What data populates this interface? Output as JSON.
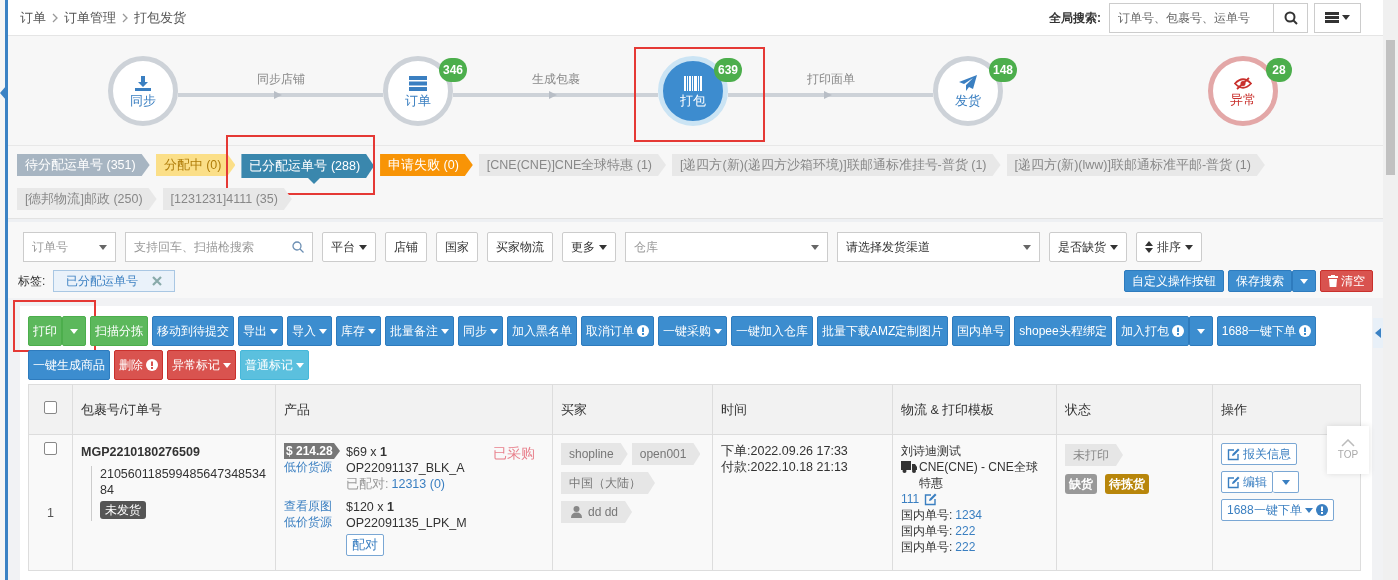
{
  "breadcrumb": [
    "订单",
    "订单管理",
    "打包发货"
  ],
  "global_search": {
    "label": "全局搜索:",
    "placeholder": "订单号、包裹号、运单号"
  },
  "steps": [
    {
      "kind": "sync",
      "label": "同步",
      "next_label": "同步店铺",
      "selected": false,
      "annotated": false
    },
    {
      "kind": "order",
      "label": "订单",
      "count": "346",
      "next_label": "生成包裹",
      "selected": false,
      "annotated": false
    },
    {
      "kind": "pack",
      "label": "打包",
      "count": "639",
      "next_label": "打印面单",
      "selected": true,
      "annotated": true
    },
    {
      "kind": "ship",
      "label": "发货",
      "count": "148",
      "selected": false,
      "annotated": false
    },
    {
      "kind": "abnormal",
      "label": "异常",
      "count": "28",
      "selected": false,
      "annotated": false
    }
  ],
  "status_tabs": [
    {
      "label": "待分配运单号 (351)",
      "color": "#a7b5c2",
      "selected": false,
      "annotated": false
    },
    {
      "label": "分配中 (0)",
      "color": "#fbdf88",
      "selected": false,
      "annotated": false
    },
    {
      "label": "已分配运单号 (288)",
      "color": "#3a87ad",
      "selected": true,
      "annotated": true
    },
    {
      "label": "申请失败 (0)",
      "color": "#f89406",
      "selected": false,
      "annotated": false
    },
    {
      "label": "[CNE(CNE)]CNE全球特惠 (1)",
      "color": "#e8e8e8",
      "selected": false,
      "annotated": false
    },
    {
      "label": "[递四方(新)(递四方沙箱环境)]联邮通标准挂号-普货 (1)",
      "color": "#e8e8e8",
      "selected": false,
      "annotated": false
    },
    {
      "label": "[递四方(新)(lww)]联邮通标准平邮-普货 (1)",
      "color": "#e8e8e8",
      "selected": false,
      "annotated": false
    },
    {
      "label": "[德邦物流]邮政 (250)",
      "color": "#e8e8e8",
      "selected": false,
      "annotated": false
    },
    {
      "label": "[1231231]4111 (35)",
      "color": "#e8e8e8",
      "selected": false,
      "annotated": false
    }
  ],
  "filters": [
    {
      "kind": "key-select",
      "placeholder": "订单号"
    },
    {
      "kind": "search",
      "placeholder": "支持回车、扫描枪搜索"
    },
    {
      "kind": "button",
      "label": "平台",
      "caret": true
    },
    {
      "kind": "button",
      "label": "店铺",
      "caret": false
    },
    {
      "kind": "button",
      "label": "国家",
      "caret": false
    },
    {
      "kind": "button",
      "label": "买家物流",
      "caret": false
    },
    {
      "kind": "button",
      "label": "更多",
      "caret": true
    },
    {
      "kind": "select",
      "placeholder": "仓库"
    },
    {
      "kind": "select",
      "value": "请选择发货渠道"
    },
    {
      "kind": "button",
      "label": "是否缺货",
      "caret": true
    },
    {
      "kind": "sort",
      "label": "排序",
      "caret": true
    }
  ],
  "tag_filter": {
    "label": "标签:",
    "chips": [
      "已分配运单号"
    ]
  },
  "search_actions": [
    {
      "label": "自定义操作按钮",
      "kind": "action",
      "split": false
    },
    {
      "label": "保存搜索",
      "kind": "action",
      "split": true
    },
    {
      "label": "清空",
      "kind": "clear",
      "split": false
    }
  ],
  "toolbar": [
    {
      "label": "打印",
      "kind": "go",
      "split": true,
      "caret": false,
      "alert": false,
      "annotated": true
    },
    {
      "label": "扫描分拣",
      "kind": "go",
      "split": false,
      "caret": false,
      "alert": false,
      "annotated": false
    },
    {
      "label": "移动到待提交",
      "kind": "action",
      "split": false,
      "caret": false,
      "alert": false,
      "annotated": false
    },
    {
      "label": "导出",
      "kind": "action",
      "split": false,
      "caret": true,
      "alert": false,
      "annotated": false
    },
    {
      "label": "导入",
      "kind": "action",
      "split": false,
      "caret": true,
      "alert": false,
      "annotated": false
    },
    {
      "label": "库存",
      "kind": "action",
      "split": false,
      "caret": true,
      "alert": false,
      "annotated": false
    },
    {
      "label": "批量备注",
      "kind": "action",
      "split": false,
      "caret": true,
      "alert": false,
      "annotated": false
    },
    {
      "label": "同步",
      "kind": "action",
      "split": false,
      "caret": true,
      "alert": false,
      "annotated": false
    },
    {
      "label": "加入黑名单",
      "kind": "action",
      "split": false,
      "caret": false,
      "alert": false,
      "annotated": false
    },
    {
      "label": "取消订单",
      "kind": "action",
      "split": false,
      "caret": false,
      "alert": true,
      "annotated": false
    },
    {
      "label": "一键采购",
      "kind": "action",
      "split": false,
      "caret": true,
      "alert": false,
      "annotated": false
    },
    {
      "label": "一键加入仓库",
      "kind": "action",
      "split": false,
      "caret": false,
      "alert": false,
      "annotated": false
    },
    {
      "label": "批量下载AMZ定制图片",
      "kind": "action",
      "split": false,
      "caret": false,
      "alert": false,
      "annotated": false
    },
    {
      "label": "国内单号",
      "kind": "action",
      "split": false,
      "caret": false,
      "alert": false,
      "annotated": false
    },
    {
      "label": "shopee头程绑定",
      "kind": "action",
      "split": false,
      "caret": false,
      "alert": false,
      "annotated": false
    },
    {
      "label": "加入打包",
      "kind": "action",
      "split": true,
      "caret": false,
      "alert": true,
      "annotated": false
    },
    {
      "label": "1688一键下单",
      "kind": "action",
      "split": false,
      "caret": false,
      "alert": true,
      "annotated": false
    },
    {
      "label": "一键生成商品",
      "kind": "action",
      "split": false,
      "caret": false,
      "alert": false,
      "annotated": false
    },
    {
      "label": "删除",
      "kind": "delete",
      "split": false,
      "caret": false,
      "alert": true,
      "annotated": false
    },
    {
      "label": "异常标记",
      "kind": "delete",
      "split": false,
      "caret": true,
      "alert": false,
      "annotated": false
    },
    {
      "label": "普通标记",
      "kind": "mark",
      "split": false,
      "caret": true,
      "alert": false,
      "annotated": false
    }
  ],
  "table": {
    "all_checked": false,
    "columns": [
      "包裹号/订单号",
      "产品",
      "买家",
      "时间",
      "物流 & 打印模板",
      "状态",
      "操作"
    ],
    "rows": [
      {
        "checked": false,
        "index": "1",
        "package_no": "MGP2210180276509",
        "order_no": "21056011859948564734853484",
        "ship_status": "未发货",
        "products": [
          {
            "price_tag": "$ 214.28",
            "links": [
              "低价货源"
            ],
            "price": "$69 x **1**",
            "sku": "OP22091137_BLK_A",
            "matched_label": "已配对:",
            "matched_value": "12313 (0)",
            "purchased": "已采购"
          },
          {
            "links": [
              "查看原图",
              "低价货源"
            ],
            "price": "$120 x **1**",
            "sku": "OP22091135_LPK_M",
            "match_button": "配对"
          }
        ],
        "buyer_tags": [
          "shopline",
          "open001",
          "中国（大陆）"
        ],
        "buyer_name": "dd dd",
        "times": [
          "下单:2022.09.26 17:33",
          "付款:2022.10.18 21:13"
        ],
        "logistics": {
          "name": "刘诗迪测试",
          "channel": "CNE(CNE) - CNE全球特惠",
          "tracking": "111",
          "domestic": [
            {
              "label": "国内单号:",
              "value": "1234"
            },
            {
              "label": "国内单号:",
              "value": "222"
            },
            {
              "label": "国内单号:",
              "value": "222"
            }
          ]
        },
        "print_status": "未打印",
        "badges": [
          {
            "text": "缺货",
            "color": "#999999"
          },
          {
            "text": "待拣货",
            "color": "#b8860b"
          }
        ],
        "actions": [
          {
            "label": "报关信息",
            "kind": "edit"
          },
          {
            "label": "编辑",
            "kind": "edit-split"
          },
          {
            "label": "1688一键下单",
            "kind": "caret-alert"
          }
        ]
      }
    ]
  },
  "back_to_top": "TOP"
}
